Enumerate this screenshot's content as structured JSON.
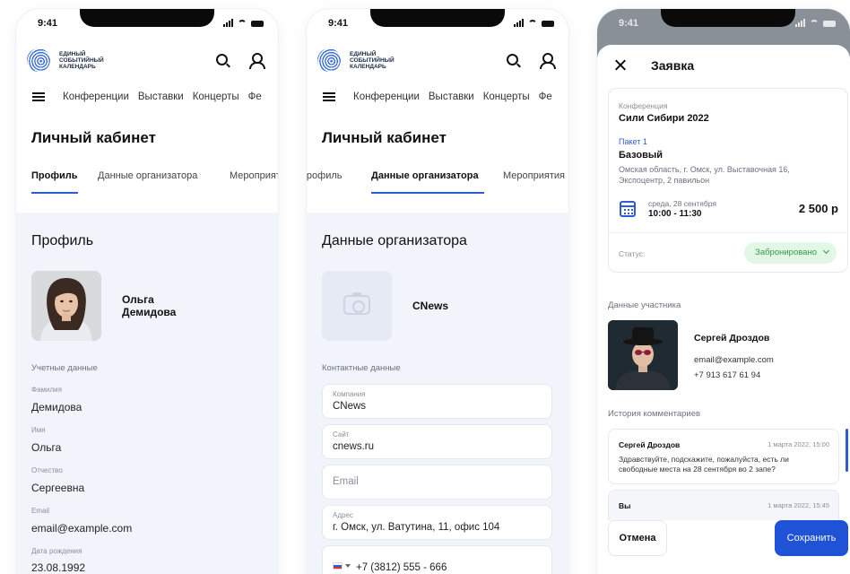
{
  "status_time": "9:41",
  "logo": {
    "line1": "ЕДИНЫЙ",
    "line2": "СОБЫТИЙНЫЙ",
    "line3": "КАЛЕНДАРЬ"
  },
  "nav": [
    "Конференции",
    "Выставки",
    "Концерты",
    "Фе"
  ],
  "cabinet_title": "Личный кабинет",
  "tabs": {
    "profile": "Профиль",
    "organizer": "Данные организатора",
    "events": "Мероприятия"
  },
  "profile": {
    "section_title": "Профиль",
    "first_name": "Ольга",
    "last_name": "Демидова",
    "group_label": "Учетные данные",
    "fields": [
      {
        "label": "Фамилия",
        "value": "Демидова"
      },
      {
        "label": "Имя",
        "value": "Ольга"
      },
      {
        "label": "Отчество",
        "value": "Сергеевна"
      },
      {
        "label": "Email",
        "value": "email@example.com"
      },
      {
        "label": "Дата рождения",
        "value": "23.08.1992"
      }
    ]
  },
  "organizer": {
    "section_title": "Данные организатора",
    "company_name": "CNews",
    "group_label": "Контактные данные",
    "fields": [
      {
        "label": "Компания",
        "value": "CNews"
      },
      {
        "label": "Сайт",
        "value": "cnews.ru"
      },
      {
        "label": "",
        "placeholder": "Email"
      },
      {
        "label": "Адрес",
        "value": "г. Омск, ул. Ватутина, 11, офис 104"
      },
      {
        "label": "",
        "value": "+7 (3812) 555 - 666"
      }
    ]
  },
  "request": {
    "title": "Заявка",
    "conference_label": "Конференция",
    "conference_name": "Сили Сибири 2022",
    "package_label": "Пакет 1",
    "package_name": "Базовый",
    "address_line1": "Омская область, г. Омск, ул. Выставочная 16,",
    "address_line2": "Экспоцентр, 2 павильон",
    "date": "среда, 28 сентября",
    "time": "10:00 - 11:30",
    "price": "2 500 р",
    "status_label": "Статус:",
    "status_value": "Забронировано",
    "status_color": "#2f9b4a",
    "participant_label": "Данные участника",
    "participant_name": "Сергей Дроздов",
    "participant_email": "email@example.com",
    "participant_phone": "+7 913 617 61 94",
    "comments_label": "История комментариев",
    "comments": [
      {
        "author": "Сергей Дроздов",
        "date": "1 марта 2022, 15:00",
        "text1": "Здравствуйте, подскажите, пожалуйста, есть ли",
        "text2": "свободные места на 28 сентября во 2 запе?"
      },
      {
        "author": "Вы",
        "date": "1 марта 2022, 15:45"
      }
    ],
    "cancel_label": "Отмена",
    "save_label": "Сохранить"
  },
  "colors": {
    "accent": "#2f5bd8",
    "save_button": "#1f52d6",
    "status_bg": "#e2f7e6",
    "content_bg": "#f1f4fb"
  }
}
